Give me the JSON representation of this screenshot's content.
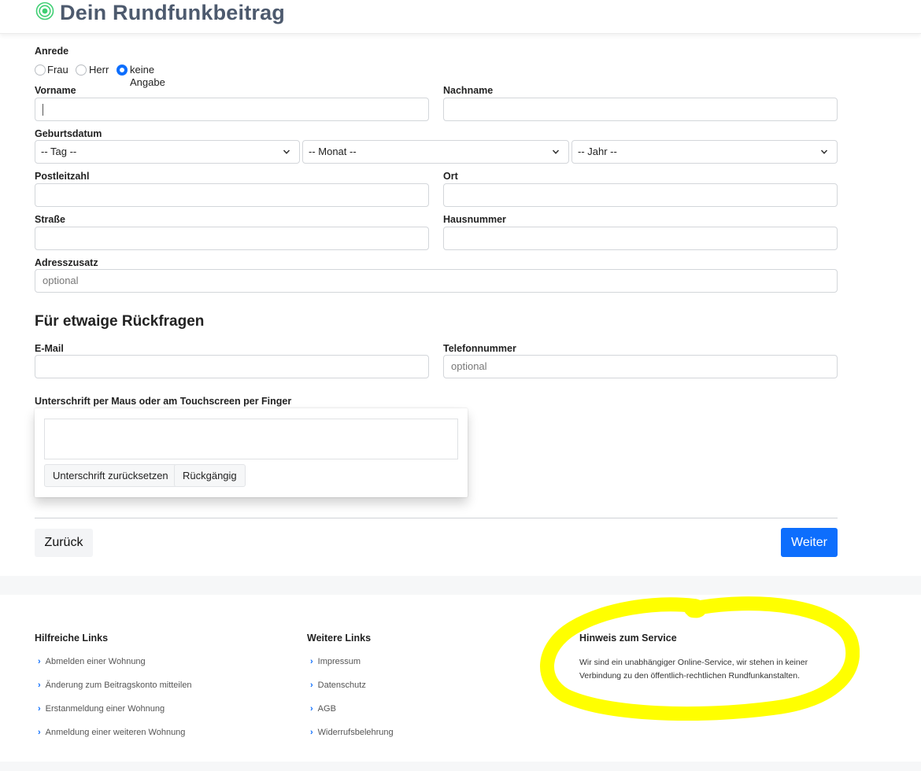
{
  "header": {
    "brand": "Dein Rundfunkbeitrag"
  },
  "form": {
    "anrede_label": "Anrede",
    "anrede_options": [
      "Frau",
      "Herr",
      "keine Angabe"
    ],
    "anrede_selected": "keine Angabe",
    "vorname_label": "Vorname",
    "nachname_label": "Nachname",
    "geburtsdatum_label": "Geburtsdatum",
    "tag_selected": "-- Tag --",
    "monat_selected": "-- Monat --",
    "jahr_selected": "-- Jahr --",
    "plz_label": "Postleitzahl",
    "ort_label": "Ort",
    "strasse_label": "Straße",
    "hausnummer_label": "Hausnummer",
    "adresszusatz_label": "Adresszusatz",
    "adresszusatz_placeholder": "optional"
  },
  "contact": {
    "title": "Für etwaige Rückfragen",
    "email_label": "E-Mail",
    "telefon_label": "Telefonnummer",
    "telefon_placeholder": "optional"
  },
  "signature": {
    "label": "Unterschrift per Maus oder am Touchscreen per Finger",
    "reset_label": "Unterschrift zurücksetzen",
    "undo_label": "Rückgängig"
  },
  "nav": {
    "back_label": "Zurück",
    "next_label": "Weiter"
  },
  "footer": {
    "col1": {
      "title": "Hilfreiche Links",
      "links": [
        "Abmelden einer Wohnung",
        "Änderung zum Beitragskonto mitteilen",
        "Erstanmeldung einer Wohnung",
        "Anmeldung einer weiteren Wohnung"
      ]
    },
    "col2": {
      "title": "Weitere Links",
      "links": [
        "Impressum",
        "Datenschutz",
        "AGB",
        "Widerrufsbelehrung"
      ]
    },
    "col3": {
      "title": "Hinweis zum Service",
      "text": "Wir sind ein unabhängiger Online-Service, wir stehen in keiner Verbindung zu den öffentlich-rechtlichen Rundfunkanstalten."
    }
  },
  "colors": {
    "accent": "#0d6efd",
    "brand": "#4d5a6e",
    "logo": "#3fcf73",
    "highlight": "#ffff00"
  },
  "icons": {
    "logo": "radio-wave-icon",
    "select_arrow": "chevron-down-icon",
    "link_bullet": "chevron-right-icon"
  }
}
